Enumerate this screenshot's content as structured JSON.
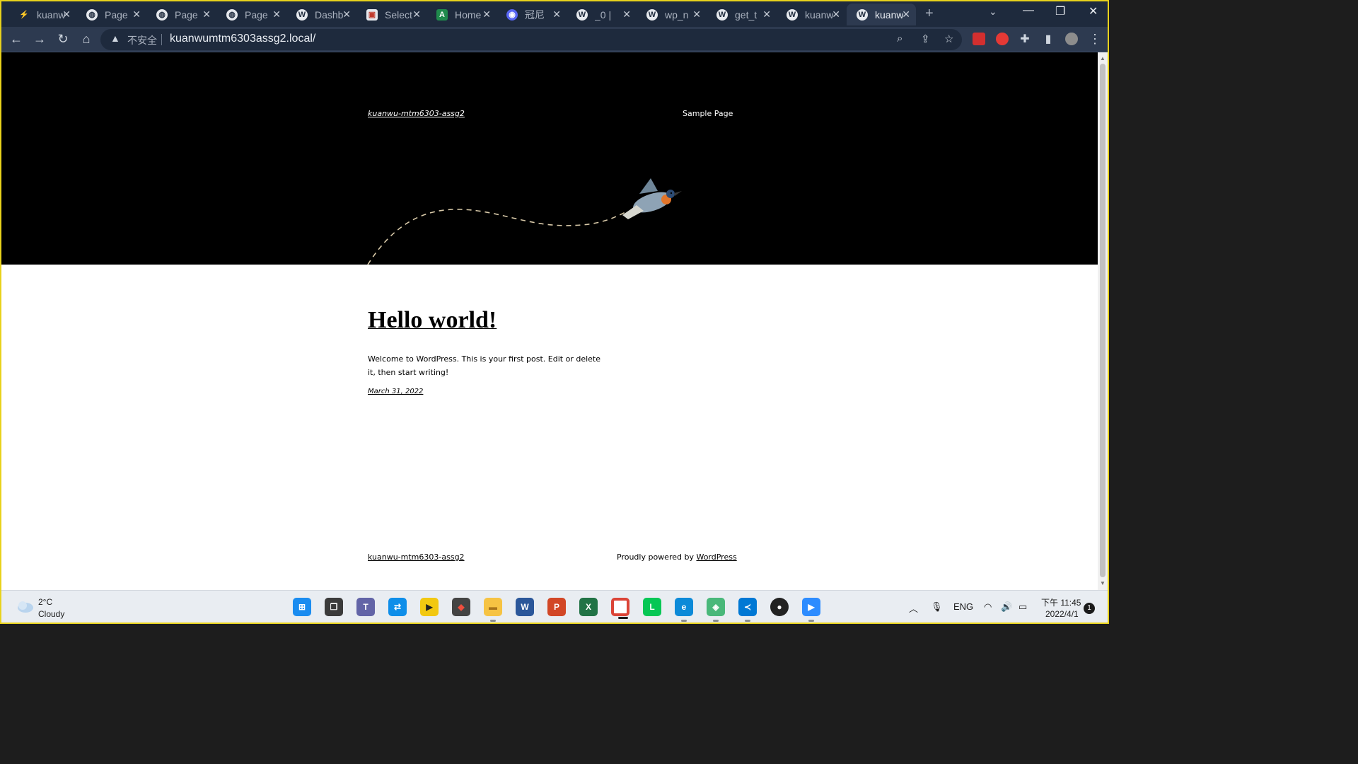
{
  "browser": {
    "tabs": [
      {
        "label": "kuanwu",
        "icon": "lightning-icon"
      },
      {
        "label": "Page",
        "icon": "globe-icon"
      },
      {
        "label": "Page",
        "icon": "globe-icon"
      },
      {
        "label": "Page",
        "icon": "globe-icon"
      },
      {
        "label": "Dashb",
        "icon": "wordpress-icon"
      },
      {
        "label": "Select",
        "icon": "app-icon"
      },
      {
        "label": "Home",
        "icon": "home-icon"
      },
      {
        "label": "冠尼",
        "icon": "discord-icon"
      },
      {
        "label": "_0 |",
        "icon": "wordpress-icon"
      },
      {
        "label": "wp_n",
        "icon": "wordpress-icon"
      },
      {
        "label": "get_t",
        "icon": "wordpress-icon"
      },
      {
        "label": "kuanw",
        "icon": "wordpress-icon"
      },
      {
        "label": "kuanw",
        "icon": "wordpress-icon",
        "active": true
      }
    ],
    "new_tab": "+",
    "security_label": "不安全",
    "url": "kuanwumtm6303assg2.local/"
  },
  "site": {
    "title": "kuanwu-mtm6303-assg2",
    "nav_item": "Sample Page",
    "post": {
      "title": "Hello world!",
      "excerpt": "Welcome to WordPress. This is your first post. Edit or delete it, then start writing!",
      "date": "March 31, 2022"
    },
    "footer": {
      "site_name": "kuanwu-mtm6303-assg2",
      "powered_prefix": "Proudly powered by ",
      "powered_link": "WordPress"
    }
  },
  "taskbar": {
    "weather": {
      "temp": "2°C",
      "condition": "Cloudy"
    },
    "language": "ENG",
    "time": "下午 11:45",
    "date": "2022/4/1",
    "notifications": "1"
  },
  "colors": {
    "tabstrip": "#1e2a3d",
    "toolbar": "#2d3a50",
    "hero": "#000000",
    "frame_border": "#e8d21c"
  }
}
